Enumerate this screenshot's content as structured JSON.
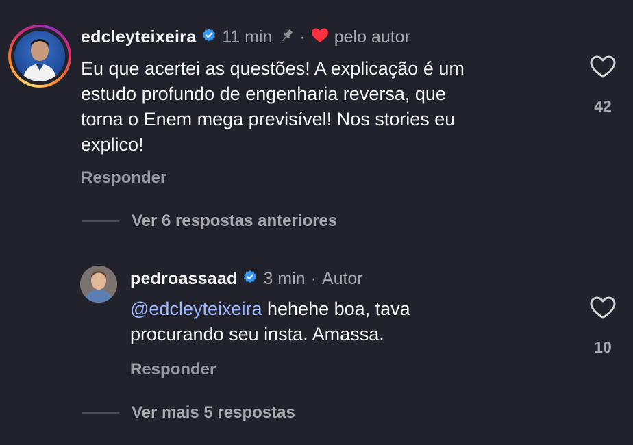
{
  "comments": [
    {
      "username": "edcleyteixeira",
      "time": "11 min",
      "separator": "·",
      "liked_by_author": "pelo autor",
      "text_lines": [
        "Eu que acertei as questões! A explicação é um",
        "estudo profundo de engenharia reversa, que",
        "torna o Enem mega previsível! Nos stories eu",
        "explico!"
      ],
      "reply_label": "Responder",
      "likes": "42",
      "view_replies": "Ver 6 respostas anteriores"
    },
    {
      "username": "pedroassaad",
      "time": "3 min",
      "separator": "·",
      "author_tag": "Autor",
      "mention": "@edcleyteixeira",
      "text_line1_rest": " hehehe boa, tava",
      "text_line2": "procurando seu insta. Amassa.",
      "reply_label": "Responder",
      "likes": "10",
      "view_replies": "Ver mais 5 respostas"
    }
  ],
  "colors": {
    "background": "#21222b",
    "verified": "#3897f0",
    "heart": "#ff3040",
    "mention": "#9bb5ff"
  },
  "icons": [
    "verified-badge-icon",
    "pin-icon",
    "heart-filled-icon",
    "heart-outline-icon"
  ]
}
